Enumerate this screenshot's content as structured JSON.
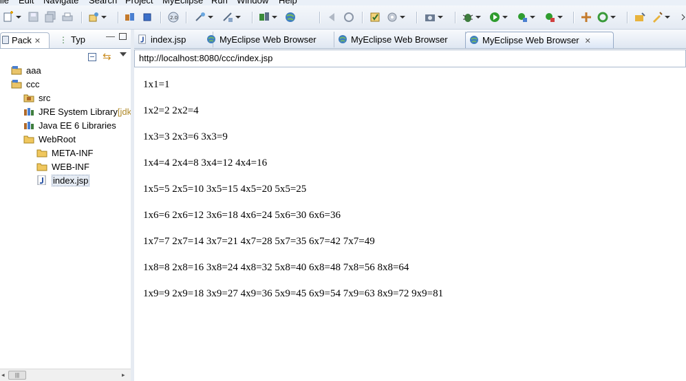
{
  "menu": [
    "ile",
    "Edit",
    "Navigate",
    "Search",
    "Project",
    "MyEclipse",
    "Run",
    "Window",
    "Help"
  ],
  "left_panel": {
    "tabs": [
      {
        "label": "Pack",
        "active": true
      },
      {
        "label": "Typ",
        "active": false
      }
    ],
    "tree": [
      {
        "label": "aaa",
        "icon": "project-icon",
        "level": 0
      },
      {
        "label": "ccc",
        "icon": "project-icon",
        "level": 0
      },
      {
        "label": "src",
        "icon": "source-folder-icon",
        "level": 1
      },
      {
        "label": "JRE System Library",
        "extra": "[jdk",
        "icon": "library-icon",
        "level": 1
      },
      {
        "label": "Java EE 6 Libraries",
        "icon": "library-icon",
        "level": 1
      },
      {
        "label": "WebRoot",
        "icon": "folder-icon",
        "level": 1
      },
      {
        "label": "META-INF",
        "icon": "folder-icon",
        "level": 2
      },
      {
        "label": "WEB-INF",
        "icon": "folder-icon",
        "level": 2
      },
      {
        "label": "index.jsp",
        "icon": "jsp-file-icon",
        "level": 2,
        "selected": true
      }
    ]
  },
  "editor": {
    "tabs": [
      {
        "label": "index.jsp",
        "icon": "jsp-file-icon",
        "active": false
      },
      {
        "label": "MyEclipse Web Browser",
        "icon": "globe-icon",
        "active": false
      },
      {
        "label": "MyEclipse Web Browser",
        "icon": "globe-icon",
        "active": false
      },
      {
        "label": "MyEclipse Web Browser",
        "icon": "globe-icon",
        "active": true
      }
    ],
    "url": "http://localhost:8080/ccc/index.jsp",
    "content_lines": [
      "1x1=1",
      "1x2=2 2x2=4",
      "1x3=3 2x3=6 3x3=9",
      "1x4=4 2x4=8 3x4=12 4x4=16",
      "1x5=5 2x5=10 3x5=15 4x5=20 5x5=25",
      "1x6=6 2x6=12 3x6=18 4x6=24 5x6=30 6x6=36",
      "1x7=7 2x7=14 3x7=21 4x7=28 5x7=35 6x7=42 7x7=49",
      "1x8=8 2x8=16 3x8=24 4x8=32 5x8=40 6x8=48 7x8=56 8x8=64",
      "1x9=9 2x9=18 3x9=27 4x9=36 5x9=45 6x9=54 7x9=63 8x9=72 9x9=81"
    ]
  },
  "scrollbar_thumb": "|||",
  "colors": {
    "toolbar_bg": "#e4eaf3",
    "tab_border": "#a9b8cc",
    "folder": "#e8b33c",
    "globe": "#3f7fbf"
  }
}
